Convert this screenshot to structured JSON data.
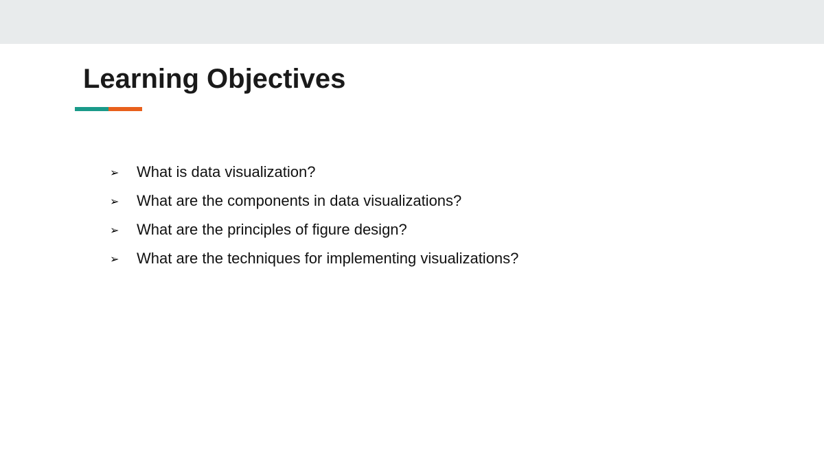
{
  "slide": {
    "title": "Learning Objectives",
    "colors": {
      "top_band": "#e8ebec",
      "accent_teal": "#1a9a8a",
      "accent_orange": "#e8601c"
    },
    "bullet_icon": "arrowhead-bullet-icon",
    "bullet_glyph": "➢",
    "objectives": [
      {
        "text": "What is data visualization?"
      },
      {
        "text": "What are the components in data visualizations?"
      },
      {
        "text": "What are the principles of figure design?"
      },
      {
        "text": "What are the techniques for implementing visualizations?"
      }
    ]
  }
}
